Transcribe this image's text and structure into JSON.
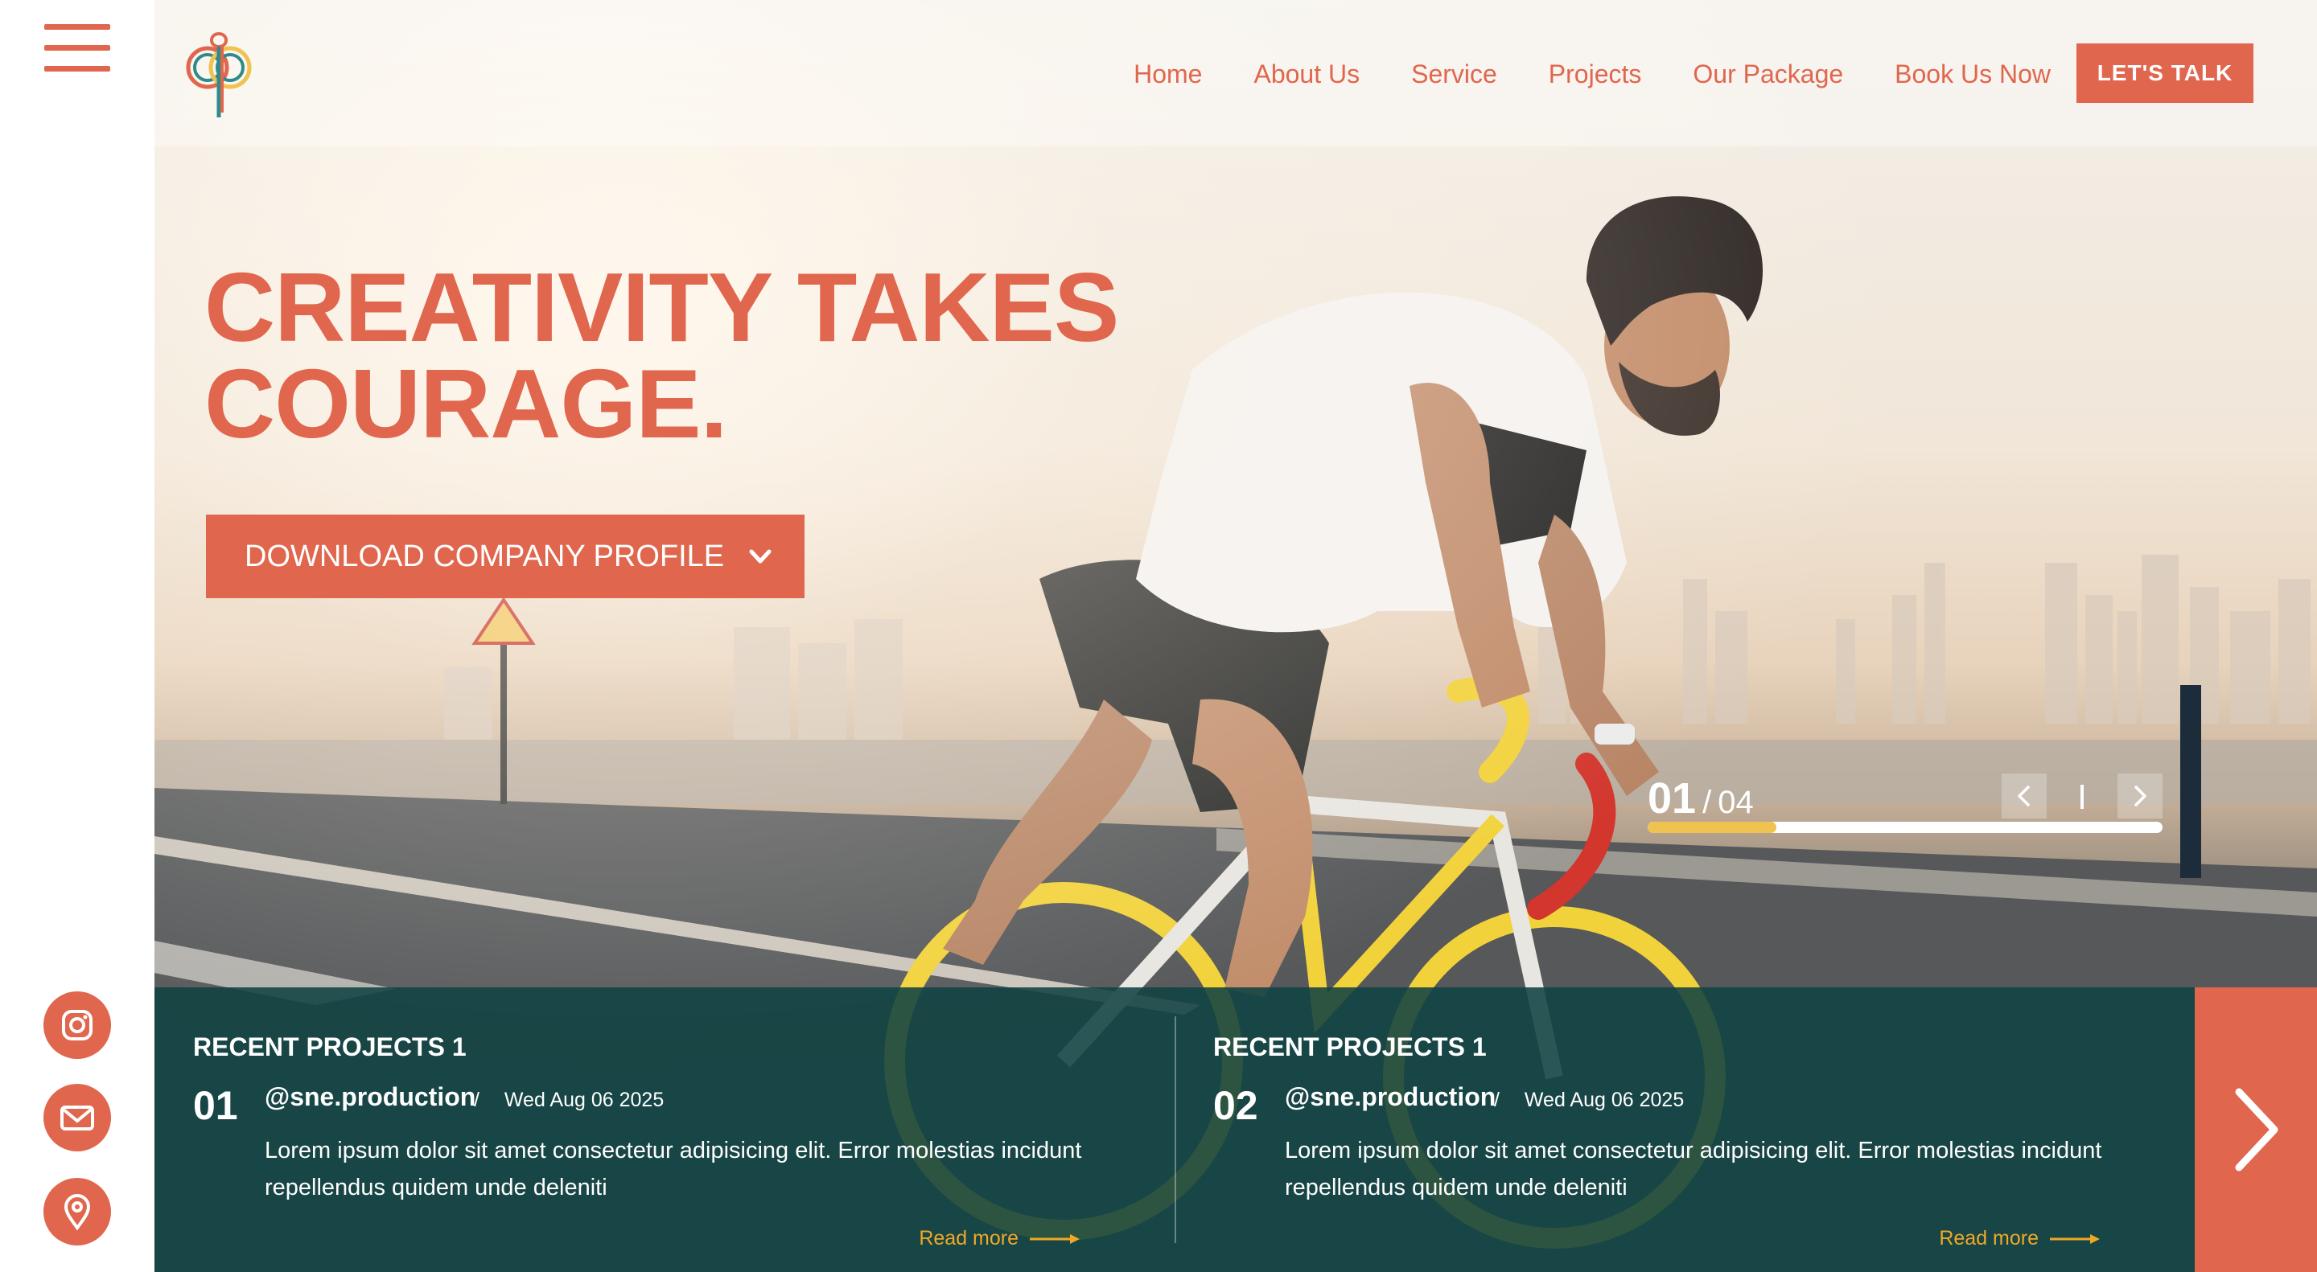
{
  "nav": {
    "items": [
      "Home",
      "About Us",
      "Service",
      "Projects",
      "Our Package",
      "Book Us Now"
    ],
    "cta": "LET'S TALK"
  },
  "hero": {
    "headline_line1": "CREATIVITY TAKES",
    "headline_line2": "COURAGE.",
    "download_label": "DOWNLOAD COMPANY PROFILE",
    "slider": {
      "current": "01",
      "separator": "/",
      "total": "04",
      "progress_fraction": 0.25
    }
  },
  "projects": [
    {
      "heading": "RECENT PROJECTS 1",
      "number": "01",
      "handle": "@sne.production",
      "date_sep": "/",
      "date": "Wed Aug 06 2025",
      "text": "Lorem ipsum dolor sit amet consectetur adipisicing elit. Error molestias incidunt repellendus quidem unde deleniti",
      "read_more": "Read more"
    },
    {
      "heading": "RECENT PROJECTS 1",
      "number": "02",
      "handle": "@sne.production",
      "date_sep": "/",
      "date": "Wed Aug 06 2025",
      "text": "Lorem ipsum dolor sit amet consectetur adipisicing elit. Error molestias incidunt repellendus quidem unde deleniti",
      "read_more": "Read more"
    }
  ],
  "icons": {
    "menu": "hamburger-menu-icon",
    "social": [
      "instagram-icon",
      "mail-icon",
      "location-pin-icon"
    ],
    "slider": [
      "chevron-left-icon",
      "chevron-right-icon"
    ],
    "next": "chevron-right-icon"
  },
  "colors": {
    "accent": "#e0664d",
    "band": "#104242",
    "progress": "#f0c24f",
    "read_more": "#f0a826"
  }
}
